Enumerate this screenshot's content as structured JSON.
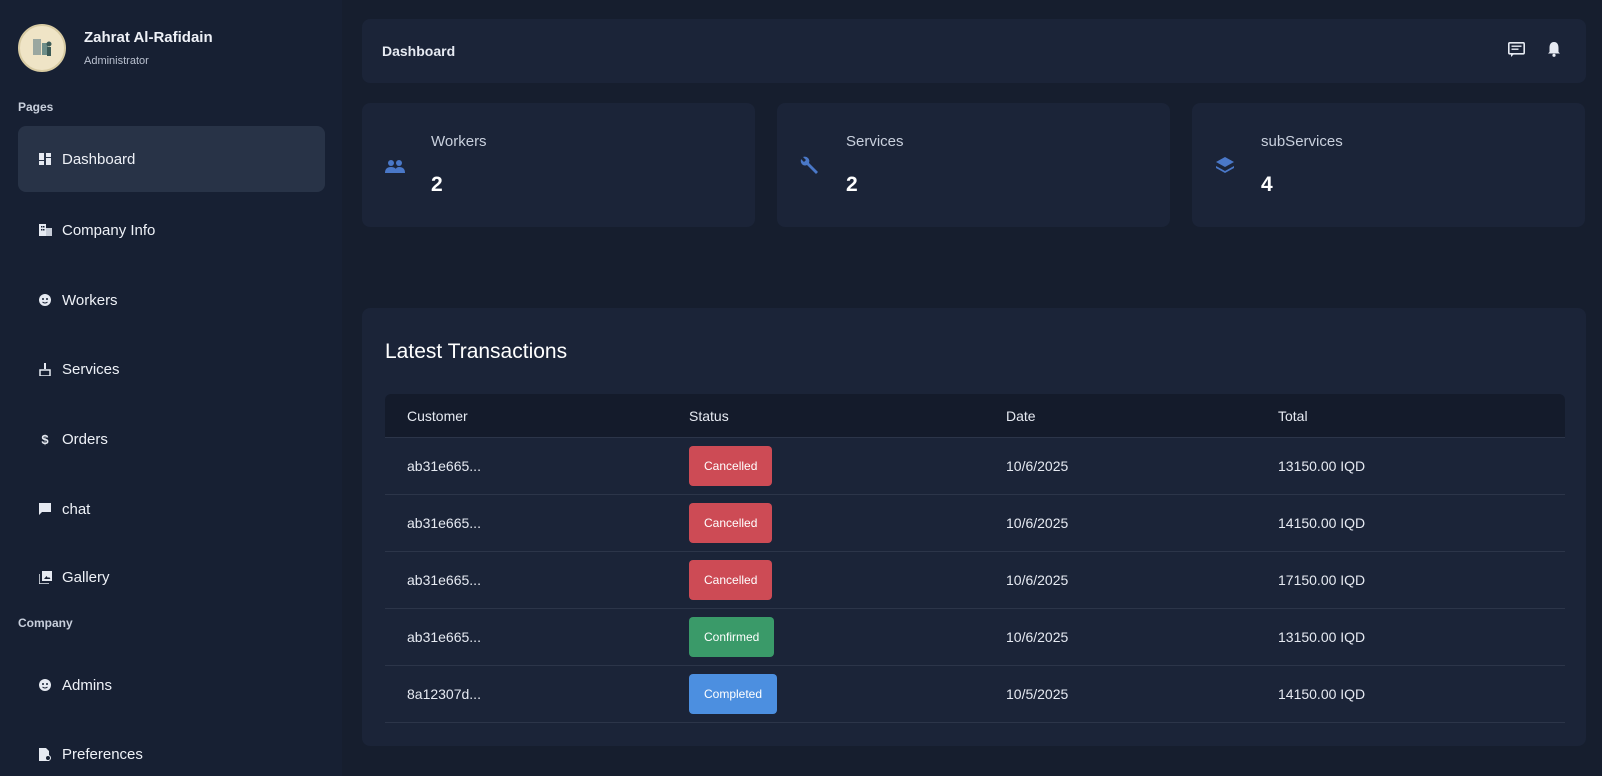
{
  "profile": {
    "name": "Zahrat Al-Rafidain",
    "role": "Administrator"
  },
  "sidebar": {
    "section_pages": "Pages",
    "section_company": "Company",
    "items": [
      {
        "label": "Dashboard",
        "icon": "dashboard-icon"
      },
      {
        "label": "Company Info",
        "icon": "building-icon"
      },
      {
        "label": "Workers",
        "icon": "face-icon"
      },
      {
        "label": "Services",
        "icon": "cleaning-icon"
      },
      {
        "label": "Orders",
        "icon": "dollar-icon"
      },
      {
        "label": "chat",
        "icon": "chat-icon"
      },
      {
        "label": "Gallery",
        "icon": "gallery-icon"
      },
      {
        "label": "Admins",
        "icon": "face-icon"
      },
      {
        "label": "Preferences",
        "icon": "settings-document-icon"
      }
    ]
  },
  "header": {
    "title": "Dashboard",
    "icons": [
      "messages-icon",
      "bell-icon"
    ]
  },
  "stats": [
    {
      "label": "Workers",
      "value": "2",
      "icon": "people-icon"
    },
    {
      "label": "Services",
      "value": "2",
      "icon": "wrench-icon"
    },
    {
      "label": "subServices",
      "value": "4",
      "icon": "layers-icon"
    }
  ],
  "transactions": {
    "title": "Latest Transactions",
    "columns": [
      "Customer",
      "Status",
      "Date",
      "Total"
    ],
    "rows": [
      {
        "customer": "ab31e665...",
        "status": "Cancelled",
        "date": "10/6/2025",
        "total": "13150.00 IQD"
      },
      {
        "customer": "ab31e665...",
        "status": "Cancelled",
        "date": "10/6/2025",
        "total": "14150.00 IQD"
      },
      {
        "customer": "ab31e665...",
        "status": "Cancelled",
        "date": "10/6/2025",
        "total": "17150.00 IQD"
      },
      {
        "customer": "ab31e665...",
        "status": "Confirmed",
        "date": "10/6/2025",
        "total": "13150.00 IQD"
      },
      {
        "customer": "8a12307d...",
        "status": "Completed",
        "date": "10/5/2025",
        "total": "14150.00 IQD"
      }
    ]
  },
  "colors": {
    "cancelled": "#cd4b55",
    "confirmed": "#3a9a69",
    "completed": "#4c8fe0",
    "accent_icon": "#4a78c8"
  }
}
